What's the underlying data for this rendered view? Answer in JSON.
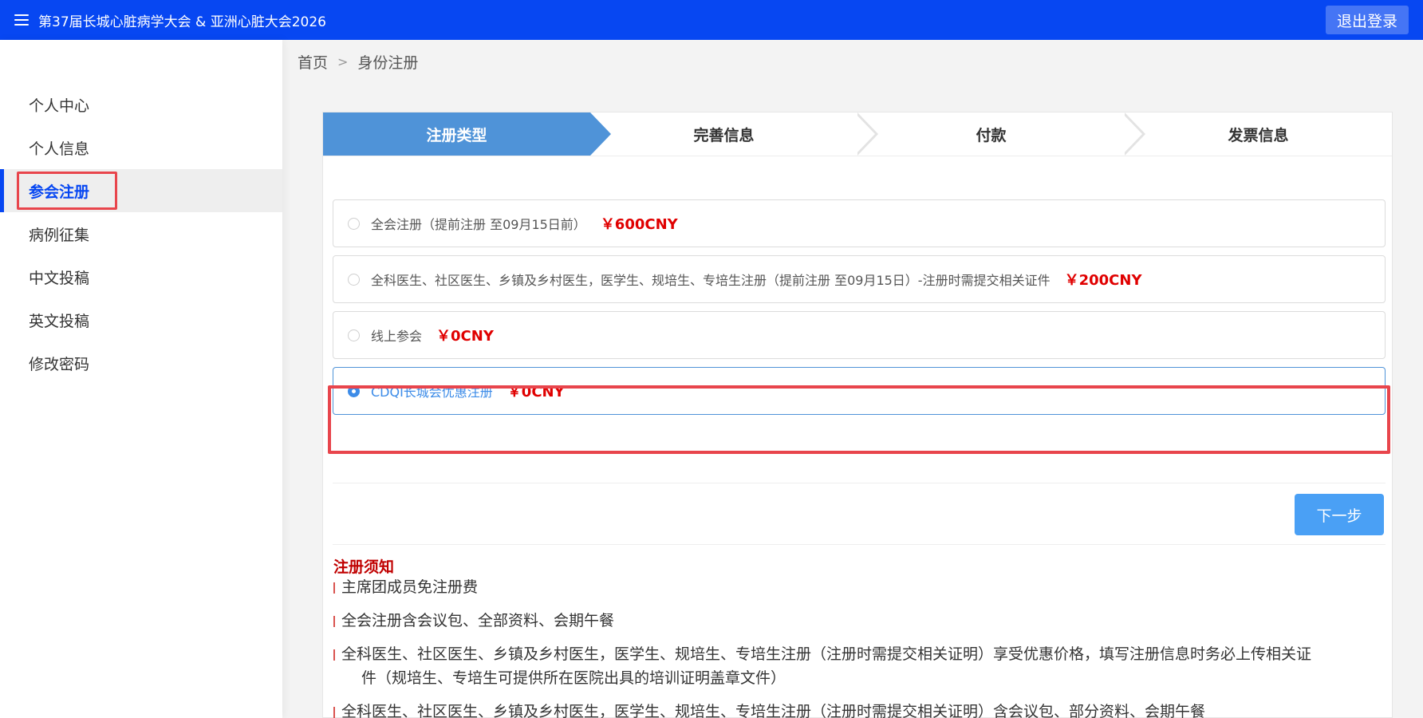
{
  "header": {
    "title": "第37届长城心脏病学大会 & 亚洲心脏大会2026",
    "logout_label": "退出登录"
  },
  "sidebar": {
    "items": [
      {
        "label": "个人中心"
      },
      {
        "label": "个人信息"
      },
      {
        "label": "参会注册",
        "active": true
      },
      {
        "label": "病例征集"
      },
      {
        "label": "中文投稿"
      },
      {
        "label": "英文投稿"
      },
      {
        "label": "修改密码"
      }
    ]
  },
  "breadcrumb": {
    "home": "首页",
    "separator": ">",
    "current": "身份注册"
  },
  "steps": [
    {
      "label": "注册类型",
      "active": true
    },
    {
      "label": "完善信息"
    },
    {
      "label": "付款"
    },
    {
      "label": "发票信息"
    }
  ],
  "options": [
    {
      "label": "全会注册（提前注册 至09月15日前）",
      "price": "￥600CNY",
      "selected": false
    },
    {
      "label": "全科医生、社区医生、乡镇及乡村医生，医学生、规培生、专培生注册（提前注册 至09月15日）-注册时需提交相关证件",
      "price": "￥200CNY",
      "selected": false
    },
    {
      "label": "线上参会",
      "price": "￥0CNY",
      "selected": false
    },
    {
      "label": "CDQI长城会优惠注册",
      "price": "￥0CNY",
      "selected": true
    }
  ],
  "next_button": "下一步",
  "notice": {
    "title": "注册须知",
    "items": [
      {
        "text": "主席团成员免注册费"
      },
      {
        "text": "全会注册含会议包、全部资料、会期午餐"
      },
      {
        "text": "全科医生、社区医生、乡镇及乡村医生，医学生、规培生、专培生注册（注册时需提交相关证明）享受优惠价格，填写注册信息时务必上传相关证",
        "cont": "件（规培生、专培生可提供所在医院出具的培训证明盖章文件）"
      },
      {
        "text": "全科医生、社区医生、乡镇及乡村医生，医学生、规培生、专培生注册（注册时需提交相关证明）含会议包、部分资料、会期午餐"
      }
    ]
  },
  "colors": {
    "topbar": "#0747f2",
    "step_active": "#4f93d8",
    "price": "#e00000",
    "highlight_frame": "#e8454c",
    "next_button": "#4aa0f5"
  }
}
